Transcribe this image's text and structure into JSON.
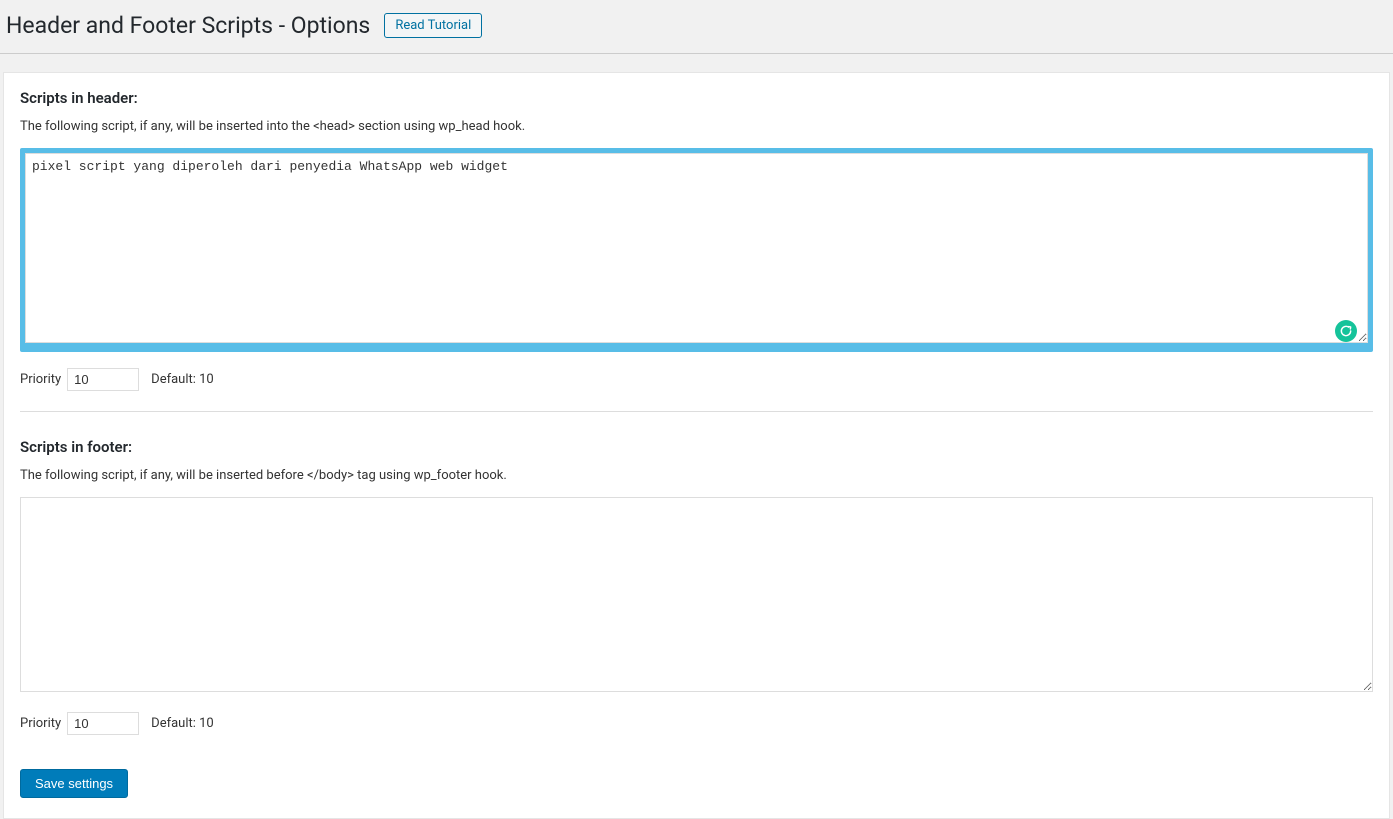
{
  "header": {
    "title": "Header and Footer Scripts - Options",
    "tutorial_label": "Read Tutorial"
  },
  "header_section": {
    "heading": "Scripts in header:",
    "desc": "The following script, if any, will be inserted into the <head> section using wp_head hook.",
    "textarea_value": "pixel script yang diperoleh dari penyedia WhatsApp web widget",
    "priority_label": "Priority",
    "priority_value": "10",
    "default_label": "Default: 10"
  },
  "footer_section": {
    "heading": "Scripts in footer:",
    "desc": "The following script, if any, will be inserted before </body> tag using wp_footer hook.",
    "textarea_value": "",
    "priority_label": "Priority",
    "priority_value": "10",
    "default_label": "Default: 10"
  },
  "save_label": "Save settings"
}
